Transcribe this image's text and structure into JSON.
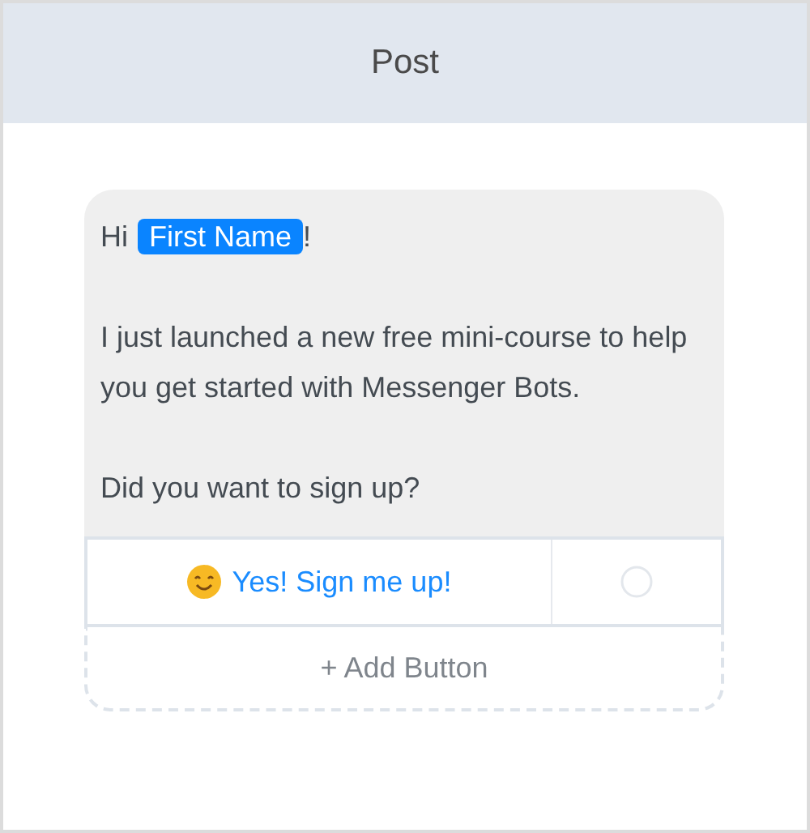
{
  "header": {
    "title": "Post"
  },
  "message": {
    "greeting": "Hi",
    "variable": "First Name",
    "greeting_end": "!",
    "paragraphs": [
      "I just launched a new free mini-course to help you get started with Messenger Bots.",
      "Did you want to sign up?"
    ]
  },
  "buttons": [
    {
      "label": "Yes! Sign me up!"
    }
  ],
  "add_button": "+ Add Button"
}
